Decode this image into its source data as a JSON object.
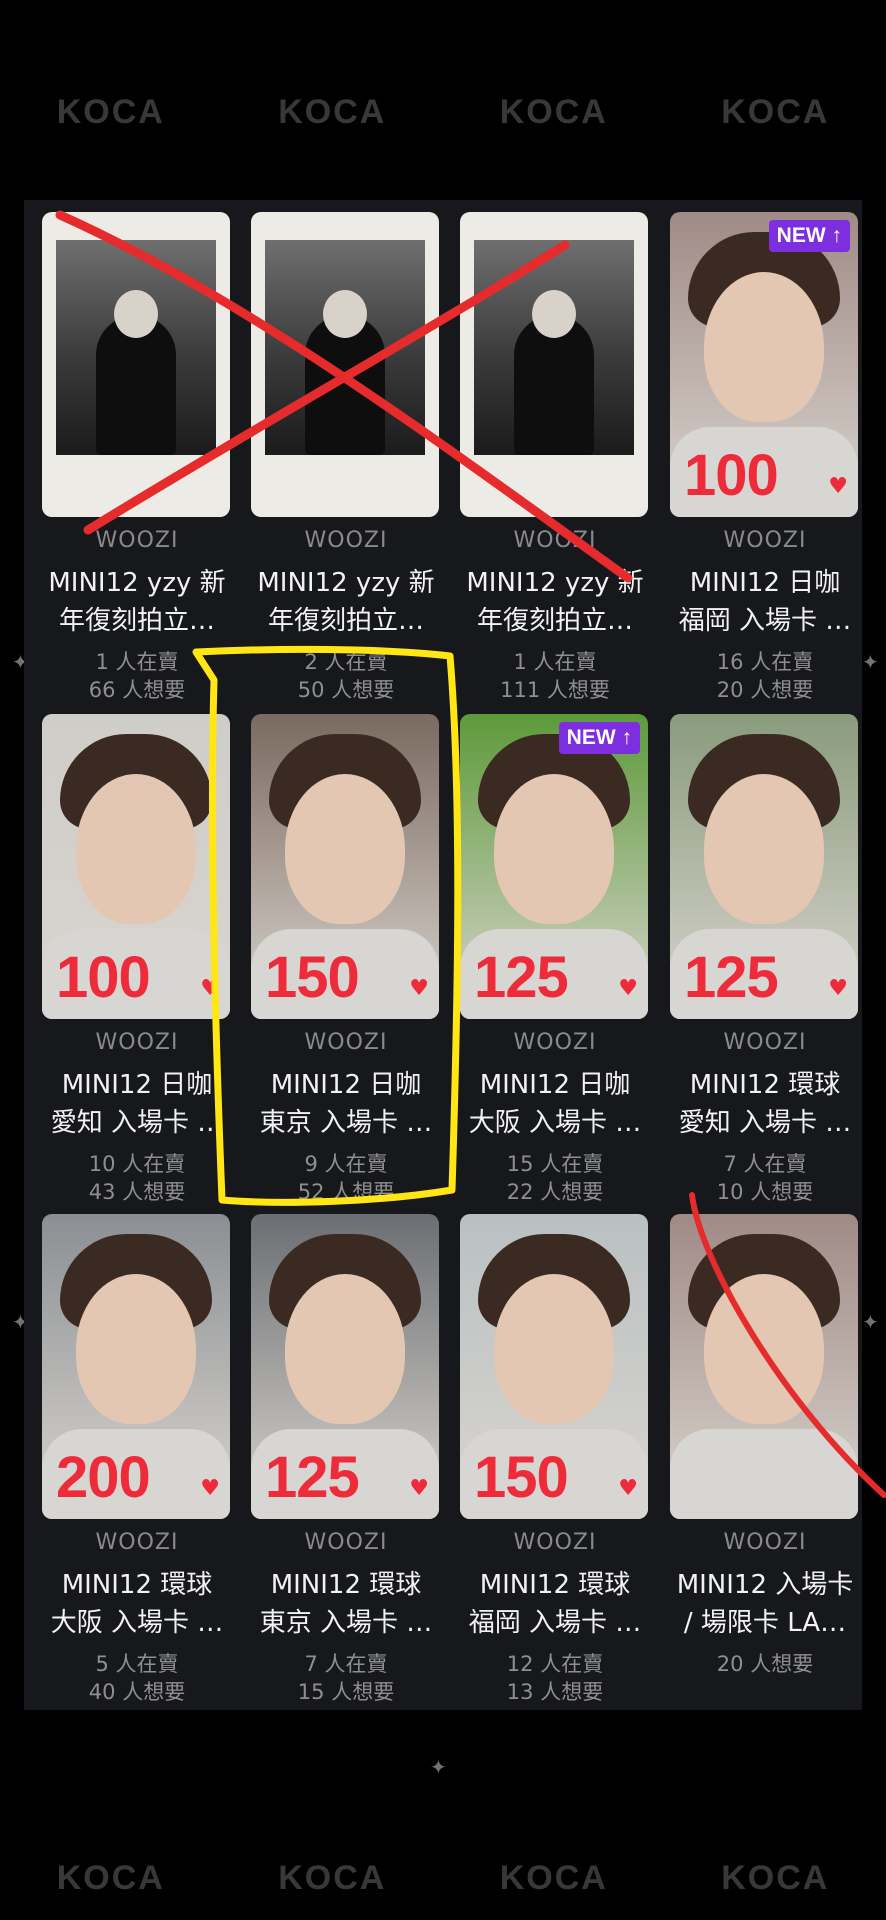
{
  "watermark": "KOCA",
  "colors": {
    "price": "#ee2b3a",
    "badge": "#7d2fe0",
    "highlight": "#ffe614",
    "cross": "#e52b2b"
  },
  "cards": [
    {
      "type": "polaroid",
      "price": "",
      "badge": "",
      "artist": "WOOZI",
      "title1": "MINI12 yzy 新",
      "title2": "年復刻拍立…",
      "selling": "1 人在賣",
      "wanting": "66 人想要"
    },
    {
      "type": "polaroid",
      "price": "",
      "badge": "",
      "artist": "WOOZI",
      "title1": "MINI12 yzy 新",
      "title2": "年復刻拍立…",
      "selling": "2 人在賣",
      "wanting": "50 人想要"
    },
    {
      "type": "polaroid",
      "price": "",
      "badge": "",
      "artist": "WOOZI",
      "title1": "MINI12 yzy 新",
      "title2": "年復刻拍立…",
      "selling": "1 人在賣",
      "wanting": "111 人想要"
    },
    {
      "type": "photo",
      "price": "100",
      "badge": "NEW ↑",
      "artist": "WOOZI",
      "title1": "MINI12 日咖",
      "title2": "福岡 入場卡 …",
      "selling": "16 人在賣",
      "wanting": "20 人想要"
    },
    {
      "type": "photo",
      "price": "100",
      "badge": "",
      "artist": "WOOZI",
      "title1": "MINI12 日咖",
      "title2": "愛知 入場卡 …",
      "selling": "10 人在賣",
      "wanting": "43 人想要"
    },
    {
      "type": "photo",
      "price": "150",
      "badge": "",
      "artist": "WOOZI",
      "title1": "MINI12 日咖",
      "title2": "東京 入場卡 …",
      "selling": "9 人在賣",
      "wanting": "52 人想要"
    },
    {
      "type": "photo",
      "price": "125",
      "badge": "NEW ↑",
      "artist": "WOOZI",
      "title1": "MINI12 日咖",
      "title2": "大阪 入場卡 …",
      "selling": "15 人在賣",
      "wanting": "22 人想要"
    },
    {
      "type": "photo",
      "price": "125",
      "badge": "",
      "artist": "WOOZI",
      "title1": "MINI12 環球",
      "title2": "愛知 入場卡 …",
      "selling": "7 人在賣",
      "wanting": "10 人想要"
    },
    {
      "type": "photo",
      "price": "200",
      "badge": "",
      "artist": "WOOZI",
      "title1": "MINI12 環球",
      "title2": "大阪 入場卡 …",
      "selling": "5 人在賣",
      "wanting": "40 人想要"
    },
    {
      "type": "photo",
      "price": "125",
      "badge": "",
      "artist": "WOOZI",
      "title1": "MINI12 環球",
      "title2": "東京 入場卡 …",
      "selling": "7 人在賣",
      "wanting": "15 人想要"
    },
    {
      "type": "photo",
      "price": "150",
      "badge": "",
      "artist": "WOOZI",
      "title1": "MINI12 環球",
      "title2": "福岡 入場卡 …",
      "selling": "12 人在賣",
      "wanting": "13 人想要"
    },
    {
      "type": "photo",
      "price": "",
      "badge": "",
      "artist": "WOOZI",
      "title1": "MINI12 入場卡",
      "title2": "/ 場限卡 LA…",
      "selling": "20 人想要",
      "wanting": ""
    }
  ]
}
